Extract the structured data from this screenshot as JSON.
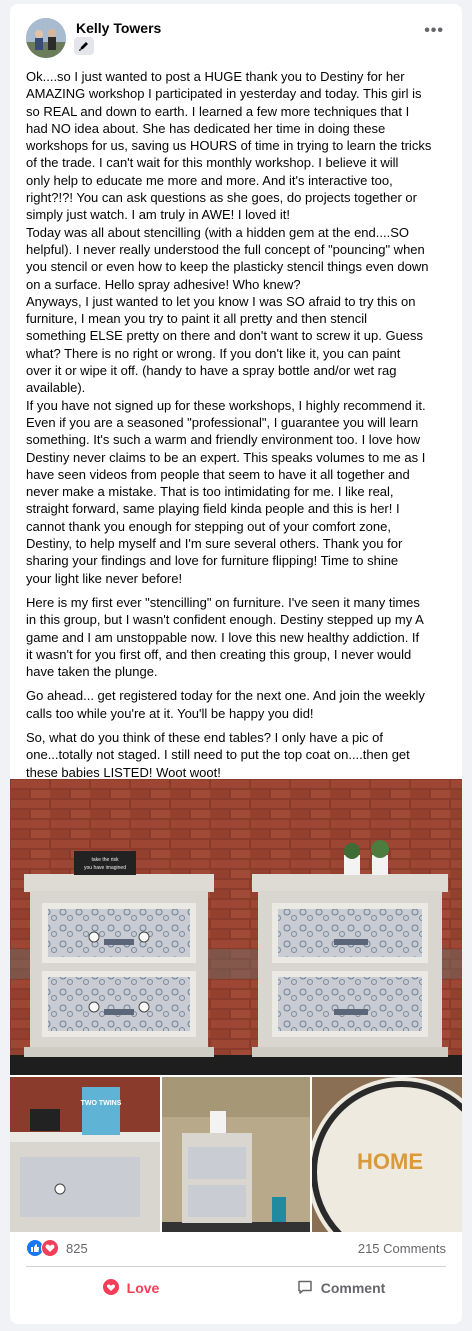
{
  "post": {
    "author": "Kelly Towers",
    "body_paragraphs": [
      [
        "Ok....so I just wanted to post a HUGE thank you to Destiny for her",
        "AMAZING workshop I participated in yesterday and today.  This girl is",
        "so REAL and down to earth.  I learned a few more techniques that I",
        "had NO idea about.  She has dedicated her time in doing these",
        "workshops for us, saving us HOURS of time in trying to learn the tricks",
        "of the trade.  I can't wait for this monthly workshop.  I believe it will",
        "only help to educate me more and more.  And it's interactive too,",
        "right?!?!  You can ask questions as she goes, do projects together or",
        "simply just watch.  I am truly in AWE!  I loved it!",
        "Today was all about stencilling (with a hidden gem at the end....SO",
        "helpful). I never really understood the full concept of \"pouncing\" when",
        "you stencil or even how to keep the plasticky stencil things even down",
        "on a surface.  Hello spray adhesive!  Who knew?",
        "Anyways, I just wanted to let you know I was SO afraid to try this on",
        "furniture, I mean you try to paint it all pretty and then stencil",
        "something ELSE pretty on there and don't want to screw it up.  Guess",
        "what?  There is no right or wrong.  If you don't like it, you can paint",
        "over it or wipe it off. (handy to have a spray bottle and/or wet rag",
        "available).",
        "If you have not signed up for these workshops, I highly recommend it.",
        "Even if you are a seasoned \"professional\", I guarantee you will learn",
        "something.  It's such a warm and friendly environment too.  I love how",
        "Destiny never claims to be an expert.  This speaks volumes to me as I",
        "have seen videos from people that seem to have it all together and",
        "never make a mistake.  That is too intimidating for me.  I like real,",
        "straight forward, same playing field kinda people and this is her!  I",
        "cannot thank you enough for stepping out of your comfort zone,",
        "Destiny, to help myself and I'm sure several others.  Thank you for",
        "sharing your findings and love for furniture flipping! Time to shine",
        "your light like never before!"
      ],
      [
        "Here is my first ever \"stencilling\" on furniture.  I've seen it many times",
        "in this group, but I wasn't confident enough.  Destiny stepped up my A",
        "game and I am unstoppable now.  I love this new healthy addiction.  If",
        "it wasn't for you first off, and then creating this group, I never would",
        "have taken the plunge."
      ],
      [
        "Go ahead... get registered today for the next one.  And join the weekly",
        "calls too while you're at it.  You'll be happy you did!"
      ],
      [
        "So, what do you think of these end tables?  I only have a pic of",
        "one...totally not staged.  I still need to put the top coat on....then get",
        "these babies LISTED!  Woot woot!"
      ]
    ],
    "photo_text": {
      "sign_line1": "take the risk",
      "sign_line2": "you have imagined",
      "book_title": "TWO TWINS",
      "mat_word": "HOME"
    },
    "reactions": {
      "count": "825",
      "comments": "215 Comments",
      "icons": [
        "like-icon",
        "love-icon"
      ]
    },
    "actions": {
      "love_label": "Love",
      "comment_label": "Comment"
    }
  },
  "colors": {
    "love": "#f33e58",
    "like": "#1877f2",
    "muted": "#65676b",
    "brick": "#8a3b2b",
    "paint": "#d9d6cf"
  }
}
